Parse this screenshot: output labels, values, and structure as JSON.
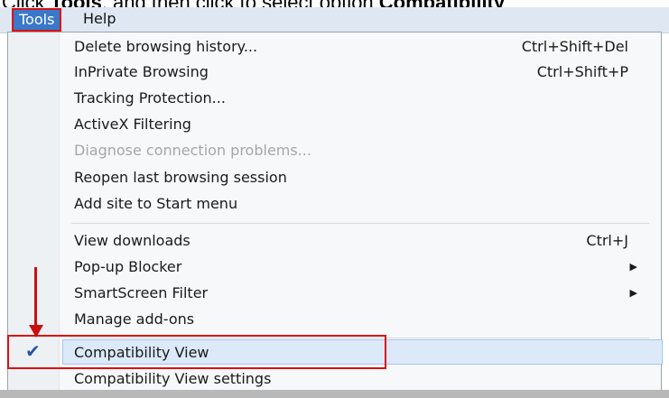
{
  "caption": {
    "pre": "Click ",
    "bold1": "Tools",
    "mid": ", and then click to select option ",
    "bold2": "Compatibility"
  },
  "menubar": {
    "tools": "Tools",
    "help": "Help"
  },
  "menu": [
    {
      "label": "Delete browsing history...",
      "shortcut": "Ctrl+Shift+Del"
    },
    {
      "label": "InPrivate Browsing",
      "shortcut": "Ctrl+Shift+P"
    },
    {
      "label": "Tracking Protection..."
    },
    {
      "label": "ActiveX Filtering"
    },
    {
      "label": "Diagnose connection problems..."
    },
    {
      "label": "Reopen last browsing session"
    },
    {
      "label": "Add site to Start menu"
    },
    {
      "label": "View downloads",
      "shortcut": "Ctrl+J"
    },
    {
      "label": "Pop-up Blocker"
    },
    {
      "label": "SmartScreen Filter"
    },
    {
      "label": "Manage add-ons"
    },
    {
      "label": "Compatibility View"
    },
    {
      "label": "Compatibility View settings"
    }
  ],
  "glyphs": {
    "submenu": "▶",
    "check": "✔"
  },
  "colors": {
    "highlight_box": "#dd1111",
    "menu_selected": "#3a78c9"
  }
}
